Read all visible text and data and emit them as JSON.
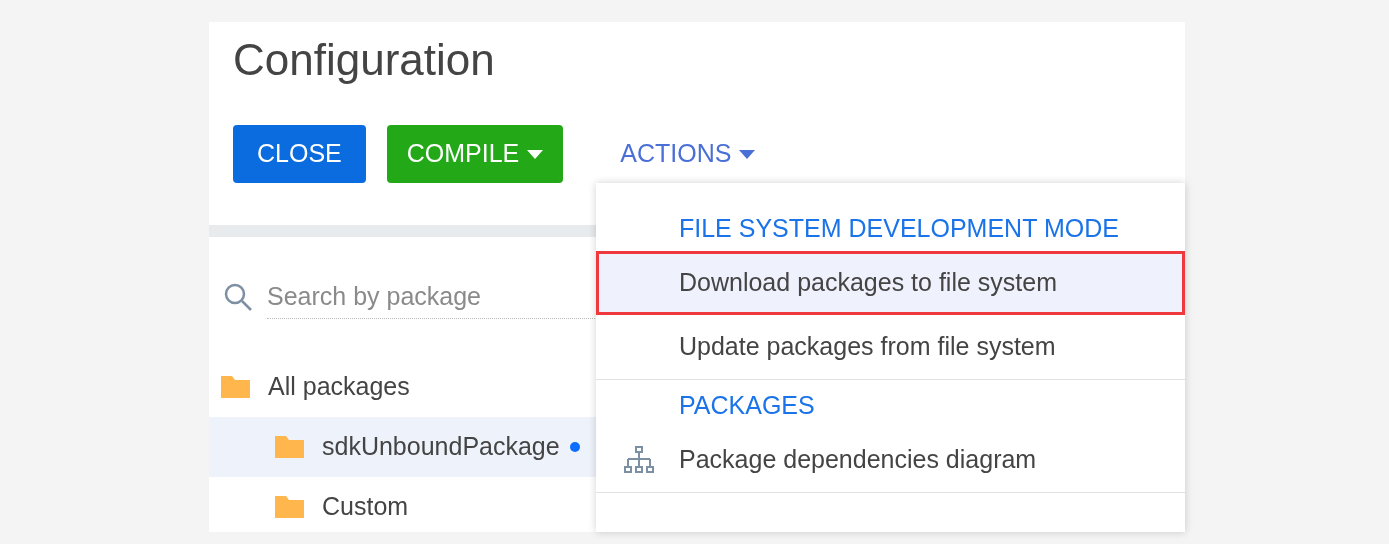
{
  "title": "Configuration",
  "buttons": [
    {
      "label": "CLOSE",
      "kind": "primary",
      "caret": false
    },
    {
      "label": "COMPILE",
      "kind": "success",
      "caret": true
    },
    {
      "label": "ACTIONS",
      "kind": "link",
      "caret": true
    }
  ],
  "search": {
    "placeholder": "Search by package"
  },
  "tree": [
    {
      "label": "All packages",
      "selected": false,
      "changed": false,
      "children": [
        {
          "label": "sdkUnboundPackage",
          "selected": true,
          "changed": true
        },
        {
          "label": "Custom",
          "selected": false,
          "changed": false
        }
      ]
    }
  ],
  "menu": [
    {
      "kind": "header",
      "label": "FILE SYSTEM DEVELOPMENT MODE"
    },
    {
      "kind": "item",
      "label": "Download packages to file system",
      "selected": true,
      "outlined": true,
      "icon": false,
      "divider_after": false
    },
    {
      "kind": "item",
      "label": "Update packages from file system",
      "selected": false,
      "outlined": false,
      "icon": false,
      "divider_after": true
    },
    {
      "kind": "header",
      "label": "PACKAGES"
    },
    {
      "kind": "item",
      "label": "Package dependencies diagram",
      "selected": false,
      "outlined": false,
      "icon": true,
      "divider_after": true
    }
  ]
}
